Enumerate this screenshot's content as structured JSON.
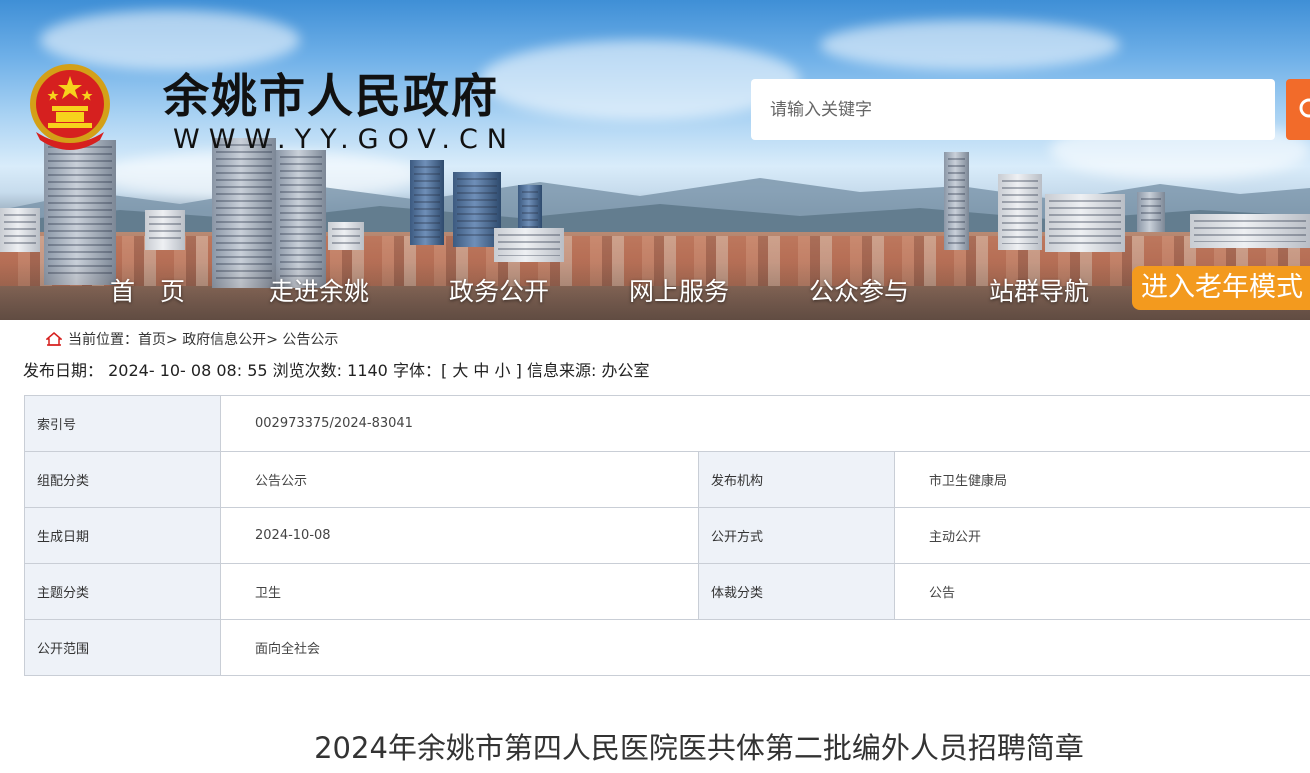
{
  "header": {
    "site_title": "余姚市人民政府",
    "site_url": "WWW.YY.GOV.CN",
    "search": {
      "placeholder": "请输入关键字"
    }
  },
  "nav": {
    "items": [
      {
        "label": "首　页"
      },
      {
        "label": "走进余姚"
      },
      {
        "label": "政务公开"
      },
      {
        "label": "网上服务"
      },
      {
        "label": "公众参与"
      },
      {
        "label": "站群导航"
      }
    ],
    "elder_mode_label": "进入老年模式"
  },
  "breadcrumb": {
    "prefix": "当前位置：",
    "items": [
      "首页",
      "政府信息公开",
      "公告公示"
    ]
  },
  "meta": {
    "publish_label": "发布日期：",
    "publish_date": "2024- 10- 08 08: 55",
    "views_label": "浏览次数:",
    "views": "1140",
    "font_label": "字体：",
    "font_open": "[",
    "font_large": "大",
    "font_medium": "中",
    "font_small": "小",
    "font_close": "]",
    "source_label": "信息来源:",
    "source": "办公室"
  },
  "info": {
    "index_no_label": "索引号",
    "index_no": "002973375/2024-83041",
    "category_label": "组配分类",
    "category": "公告公示",
    "publisher_label": "发布机构",
    "publisher": "市卫生健康局",
    "created_label": "生成日期",
    "created": "2024-10-08",
    "disclosure_label": "公开方式",
    "disclosure": "主动公开",
    "topic_label": "主题分类",
    "topic": "卫生",
    "genre_label": "体裁分类",
    "genre": "公告",
    "scope_label": "公开范围",
    "scope": "面向全社会"
  },
  "article": {
    "title": "2024年余姚市第四人民医院医共体第二批编外人员招聘简章"
  },
  "colors": {
    "search_button": "#f26b2a",
    "elder_button": "#f39a1e",
    "table_label_bg": "#eef2f8",
    "table_border": "#c9ced6"
  },
  "icons": {
    "emblem": "national-emblem-icon",
    "search": "search-icon",
    "home": "home-icon"
  }
}
